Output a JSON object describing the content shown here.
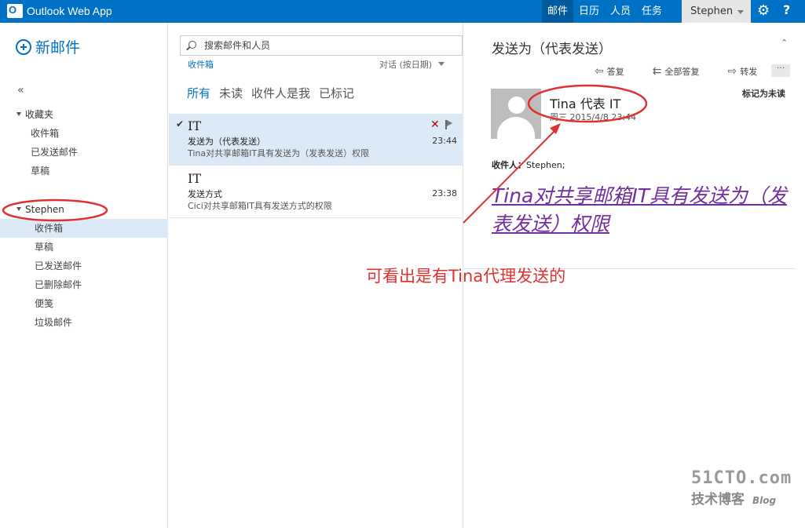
{
  "app": {
    "title": "Outlook Web App"
  },
  "topnav": {
    "mail": "邮件",
    "calendar": "日历",
    "people": "人员",
    "tasks": "任务"
  },
  "user": {
    "name": "Stephen"
  },
  "left": {
    "new_mail": "新邮件",
    "collapse": "«",
    "favorites": {
      "label": "收藏夹",
      "items": [
        "收件箱",
        "已发送邮件",
        "草稿"
      ]
    },
    "mailbox": {
      "label": "Stephen",
      "items": [
        "收件箱",
        "草稿",
        "已发送邮件",
        "已删除邮件",
        "便笺",
        "垃圾邮件"
      ]
    }
  },
  "list": {
    "search_placeholder": "搜索邮件和人员",
    "folder": "收件箱",
    "sort": "对话 (按日期)",
    "filters": [
      "所有",
      "未读",
      "收件人是我",
      "已标记"
    ],
    "messages": [
      {
        "from": "IT",
        "subject": "发送为（代表发送）",
        "preview": "Tina对共享邮箱IT具有发送为（发表发送）权限",
        "time": "23:44"
      },
      {
        "from": "IT",
        "subject": "发送方式",
        "preview": "Cici对共享邮箱IT具有发送方式的权限",
        "time": "23:38"
      }
    ]
  },
  "reading": {
    "title": "发送为（代表发送）",
    "actions": {
      "reply": "答复",
      "reply_all": "全部答复",
      "forward": "转发"
    },
    "more": "···",
    "sender": "Tina 代表 IT",
    "date": "周三 2015/4/8 23:44",
    "mark_unread": "标记为未读",
    "recipient_label": "收件人：",
    "recipient": "Stephen;",
    "body": "Tina对共享邮箱IT具有发送为（发表发送）权限"
  },
  "annotation": {
    "text": "可看出是有Tina代理发送的",
    "color": "#e03030"
  },
  "watermark": {
    "site": "51CTO.com",
    "line2": "技术博客",
    "line3": "Blog"
  },
  "colors": {
    "brand": "#0072c6",
    "selected": "#dce9f7",
    "body_text": "#7030a0"
  }
}
